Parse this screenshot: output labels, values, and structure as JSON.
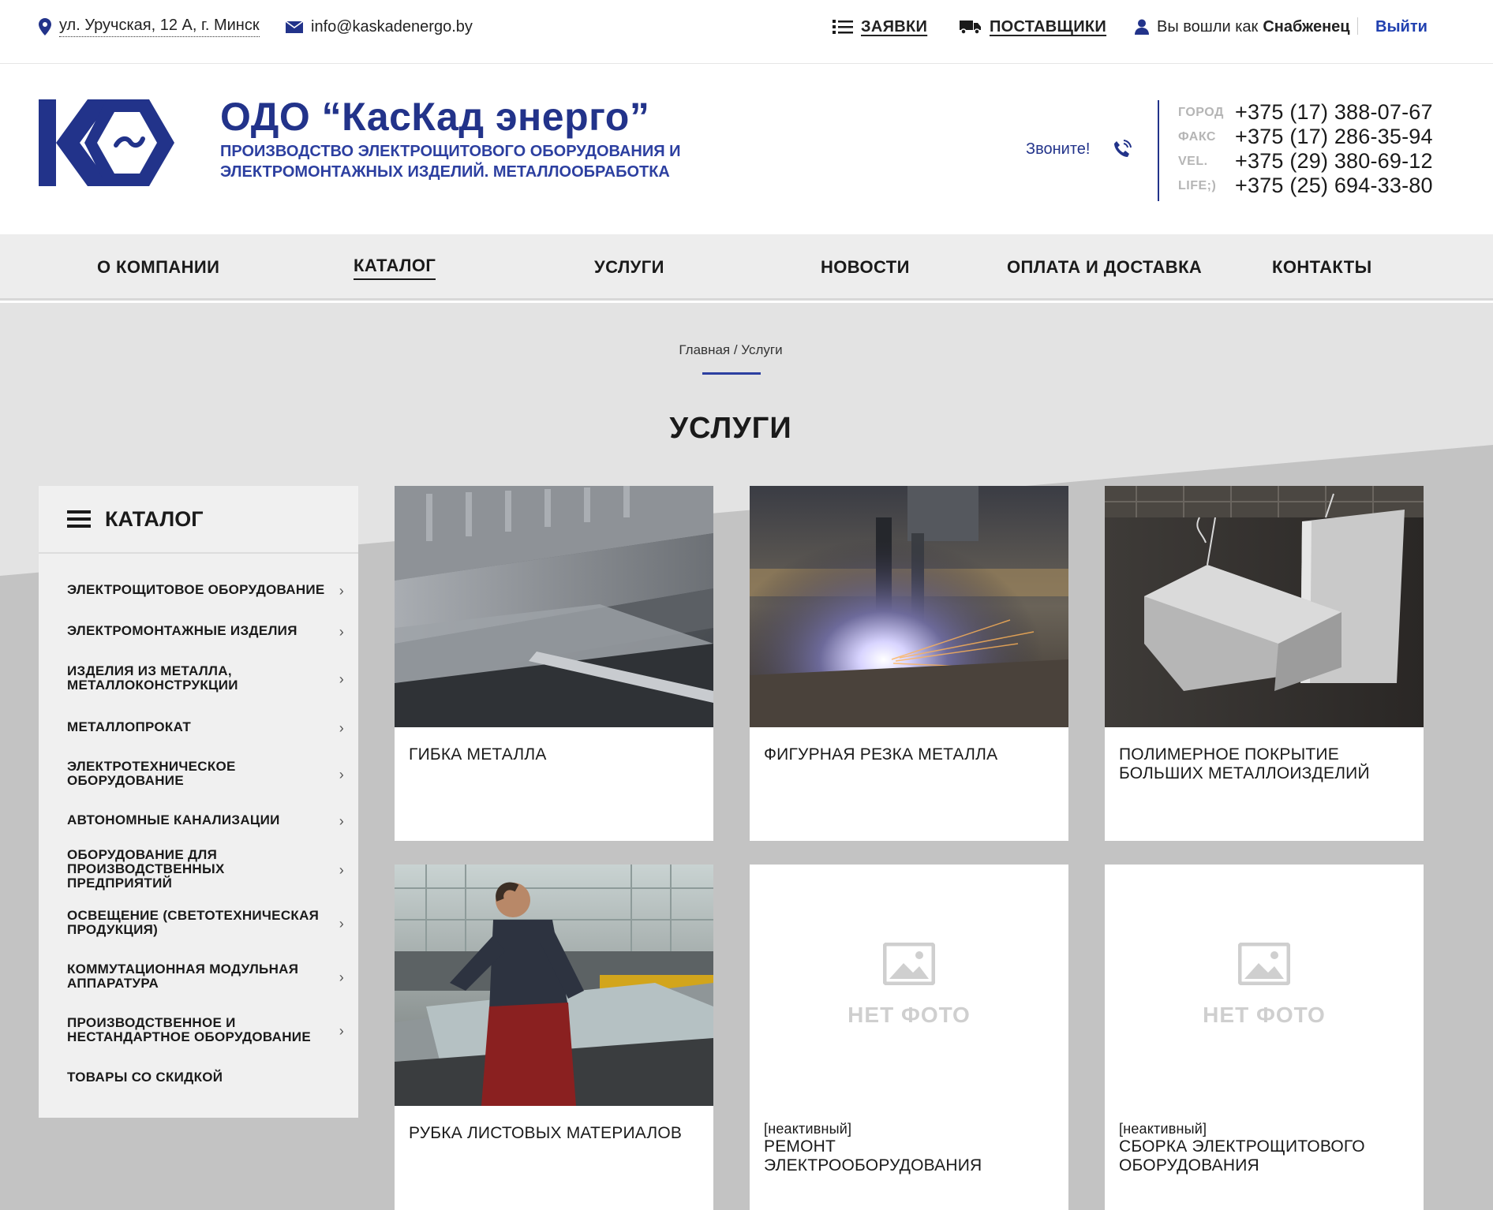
{
  "topbar": {
    "address": "ул. Уручская, 12 А, г. Минск",
    "email": "info@kaskadenergo.by",
    "requests_label": "ЗАЯВКИ",
    "suppliers_label": "ПОСТАВЩИКИ",
    "logged_in_prefix": "Вы вошли как",
    "user_name": "Снабженец",
    "logout_label": "Выйти"
  },
  "header": {
    "company_name": "ОДО “КасКад энерго”",
    "tagline": "ПРОИЗВОДСТВО ЭЛЕКТРОЩИТОВОГО ОБОРУДОВАНИЯ И ЭЛЕКТРОМОНТАЖНЫХ ИЗДЕЛИЙ. МЕТАЛЛООБРАБОТКА",
    "call_label": "Звоните!",
    "phones": [
      {
        "label": "ГОРОД",
        "number": "+375 (17) 388-07-67"
      },
      {
        "label": "ФАКС",
        "number": "+375 (17) 286-35-94"
      },
      {
        "label": "VEL.",
        "number": "+375 (29) 380-69-12"
      },
      {
        "label": "LIFE;)",
        "number": "+375 (25) 694-33-80"
      }
    ]
  },
  "nav": {
    "items": [
      {
        "label": "О КОМПАНИИ"
      },
      {
        "label": "КАТАЛОГ"
      },
      {
        "label": "УСЛУГИ"
      },
      {
        "label": "НОВОСТИ"
      },
      {
        "label": "ОПЛАТА И ДОСТАВКА"
      },
      {
        "label": "КОНТАКТЫ"
      }
    ],
    "active": "КАТАЛОГ"
  },
  "breadcrumb": "Главная / Услуги",
  "page_title": "УСЛУГИ",
  "sidebar": {
    "title": "КАТАЛОГ",
    "items": [
      {
        "label": "ЭЛЕКТРОЩИТОВОЕ ОБОРУДОВАНИЕ"
      },
      {
        "label": "ЭЛЕКТРОМОНТАЖНЫЕ ИЗДЕЛИЯ"
      },
      {
        "label": "ИЗДЕЛИЯ ИЗ МЕТАЛЛА, МЕТАЛЛОКОНСТРУКЦИИ"
      },
      {
        "label": "МЕТАЛЛОПРОКАТ"
      },
      {
        "label": "ЭЛЕКТРОТЕХНИЧЕСКОЕ ОБОРУДОВАНИЕ"
      },
      {
        "label": "АВТОНОМНЫЕ КАНАЛИЗАЦИИ"
      },
      {
        "label": "ОБОРУДОВАНИЕ ДЛЯ ПРОИЗВОДСТВЕННЫХ ПРЕДПРИЯТИЙ"
      },
      {
        "label": "ОСВЕЩЕНИЕ (СВЕТОТЕХНИЧЕСКАЯ ПРОДУКЦИЯ)"
      },
      {
        "label": "КОММУТАЦИОННАЯ МОДУЛЬНАЯ АППАРАТУРА"
      },
      {
        "label": "ПРОИЗВОДСТВЕННОЕ И НЕСТАНДАРТНОЕ ОБОРУДОВАНИЕ"
      },
      {
        "label": "ТОВАРЫ СО СКИДКОЙ"
      }
    ]
  },
  "services": [
    {
      "title": "ГИБКА МЕТАЛЛА",
      "inactive": ""
    },
    {
      "title": "ФИГУРНАЯ РЕЗКА МЕТАЛЛА",
      "inactive": ""
    },
    {
      "title": "ПОЛИМЕРНОЕ ПОКРЫТИЕ БОЛЬШИХ МЕТАЛЛОИЗДЕЛИЙ",
      "inactive": ""
    },
    {
      "title": "РУБКА ЛИСТОВЫХ МАТЕРИАЛОВ",
      "inactive": ""
    },
    {
      "title": "РЕМОНТ ЭЛЕКТРООБОРУДОВАНИЯ",
      "inactive": "[неактивный]",
      "no_photo": "НЕТ ФОТО"
    },
    {
      "title": "СБОРКА ЭЛЕКТРОЩИТОВОГО ОБОРУДОВАНИЯ",
      "inactive": "[неактивный]",
      "no_photo": "НЕТ ФОТО"
    }
  ],
  "colors": {
    "brand_blue": "#22338a",
    "accent_blue": "#2c3fa0"
  }
}
